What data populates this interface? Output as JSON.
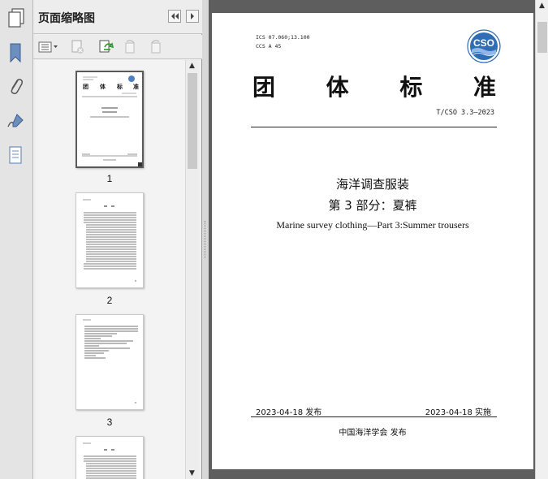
{
  "panel": {
    "title": "页面缩略图",
    "thumbnails": [
      {
        "page_label": "1",
        "selected": true
      },
      {
        "page_label": "2",
        "selected": false
      },
      {
        "page_label": "3",
        "selected": false
      },
      {
        "page_label": "",
        "selected": false
      }
    ]
  },
  "rail": {
    "icons": [
      "pages-icon",
      "bookmark-icon",
      "attachment-icon",
      "signature-icon",
      "layers-icon"
    ]
  },
  "toolbar": {
    "icons": [
      "thumbnail-options-icon",
      "delete-page-icon",
      "insert-page-icon",
      "rotate-left-icon",
      "rotate-right-icon"
    ]
  },
  "document": {
    "ics_line": "ICS 07.060;13.100",
    "ccs_line": "CCS A 45",
    "logo_text": "CSO",
    "heading": [
      "团",
      "体",
      "标",
      "准"
    ],
    "standard_no": "T/CSO 3.3—2023",
    "title_zh": "海洋调查服装",
    "part_zh": "第 3 部分：夏裤",
    "title_en": "Marine survey clothing—Part 3:Summer trousers",
    "issue_date": "2023-04-18  发布",
    "impl_date": "2023-04-18  实施",
    "publisher": "中国海洋学会  发布"
  },
  "colors": {
    "logo_blue": "#2f6db5",
    "doc_background": "#5e5e5e"
  }
}
